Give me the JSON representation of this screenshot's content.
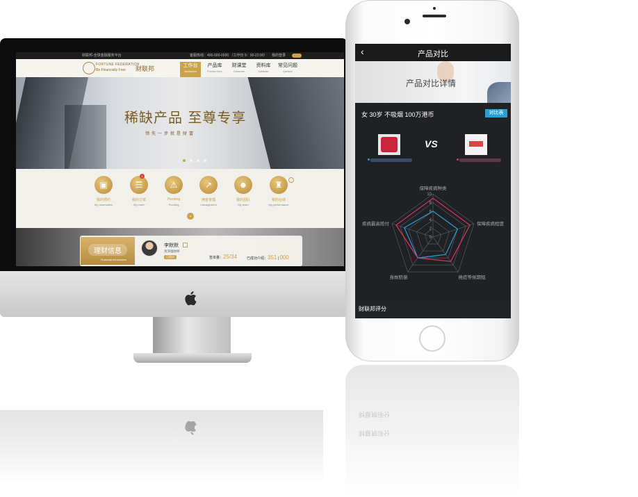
{
  "desktop": {
    "topbar": {
      "left_text": "财联邦-全球金融服务平台",
      "hotline": "客服热线：400-000-0000 （工作日 9：00-22:00）",
      "login": "我的登录"
    },
    "logo": {
      "en_line1": "FORTUNE FEDERATION",
      "en_line2": "Be Financially Free",
      "cn": "财联邦"
    },
    "nav": [
      {
        "label": "工作台",
        "en": "Workbench",
        "active": true
      },
      {
        "label": "产品库",
        "en": "Product Store",
        "active": false
      },
      {
        "label": "财课堂",
        "en": "Classroom",
        "active": false
      },
      {
        "label": "资料库",
        "en": "Database",
        "active": false
      },
      {
        "label": "常见问题",
        "en": "Question",
        "active": false
      }
    ],
    "banner": {
      "title": "稀缺产品 至尊专享",
      "subtitle": "领先一步就是财富"
    },
    "features": [
      {
        "label": "我的预约",
        "en": "My reservation",
        "icon": "calendar-icon",
        "glyph": "▣"
      },
      {
        "label": "我的订单",
        "en": "My order",
        "icon": "clipboard-icon",
        "glyph": "☰"
      },
      {
        "label": "Pending",
        "en": "Pending",
        "icon": "warning-icon",
        "glyph": "⚠"
      },
      {
        "label": "佣金管理",
        "en": "management",
        "icon": "chart-icon",
        "glyph": "↗"
      },
      {
        "label": "我的团队",
        "en": "My team",
        "icon": "team-icon",
        "glyph": "☻"
      },
      {
        "label": "我的业绩",
        "en": "My performance",
        "icon": "trophy-icon",
        "glyph": "♜"
      }
    ],
    "order_badge": "1",
    "info": {
      "tag_cn": "理财信息",
      "tag_en": "Financial information",
      "advisor_name": "李默默",
      "advisor_role": "资深理财师",
      "advisor_btn": "已签约",
      "stat1_label": "签单量：",
      "stat1_value": "25/34",
      "stat2_label": "已成功介绍：",
      "stat2_value": "351",
      "stat2_tail": "000"
    }
  },
  "mobile": {
    "title": "产品对比",
    "banner_title": "产品对比详情",
    "profile": "女   30岁   不吸烟   100万港币",
    "compare_btn": "对比表",
    "vs": "VS",
    "radar": {
      "axes": [
        "保障疾病种类",
        "保障疾病程度",
        "癌症等候期短",
        "身故赔偿",
        "疾病最高赔付"
      ],
      "ticks": [
        "10",
        "8",
        "6",
        "4",
        "2",
        "0"
      ],
      "range": [
        0,
        10
      ],
      "series": [
        {
          "color": "#2a9fd6",
          "values": [
            6,
            6,
            5,
            6,
            7
          ]
        },
        {
          "color": "#e0345a",
          "values": [
            9,
            9,
            7,
            6,
            9
          ]
        }
      ]
    },
    "footer_title": "财联邦评分"
  },
  "colors": {
    "gold": "#c9a24a",
    "dark": "#1f2124",
    "blue": "#2a9fd6",
    "red": "#e0345a"
  }
}
